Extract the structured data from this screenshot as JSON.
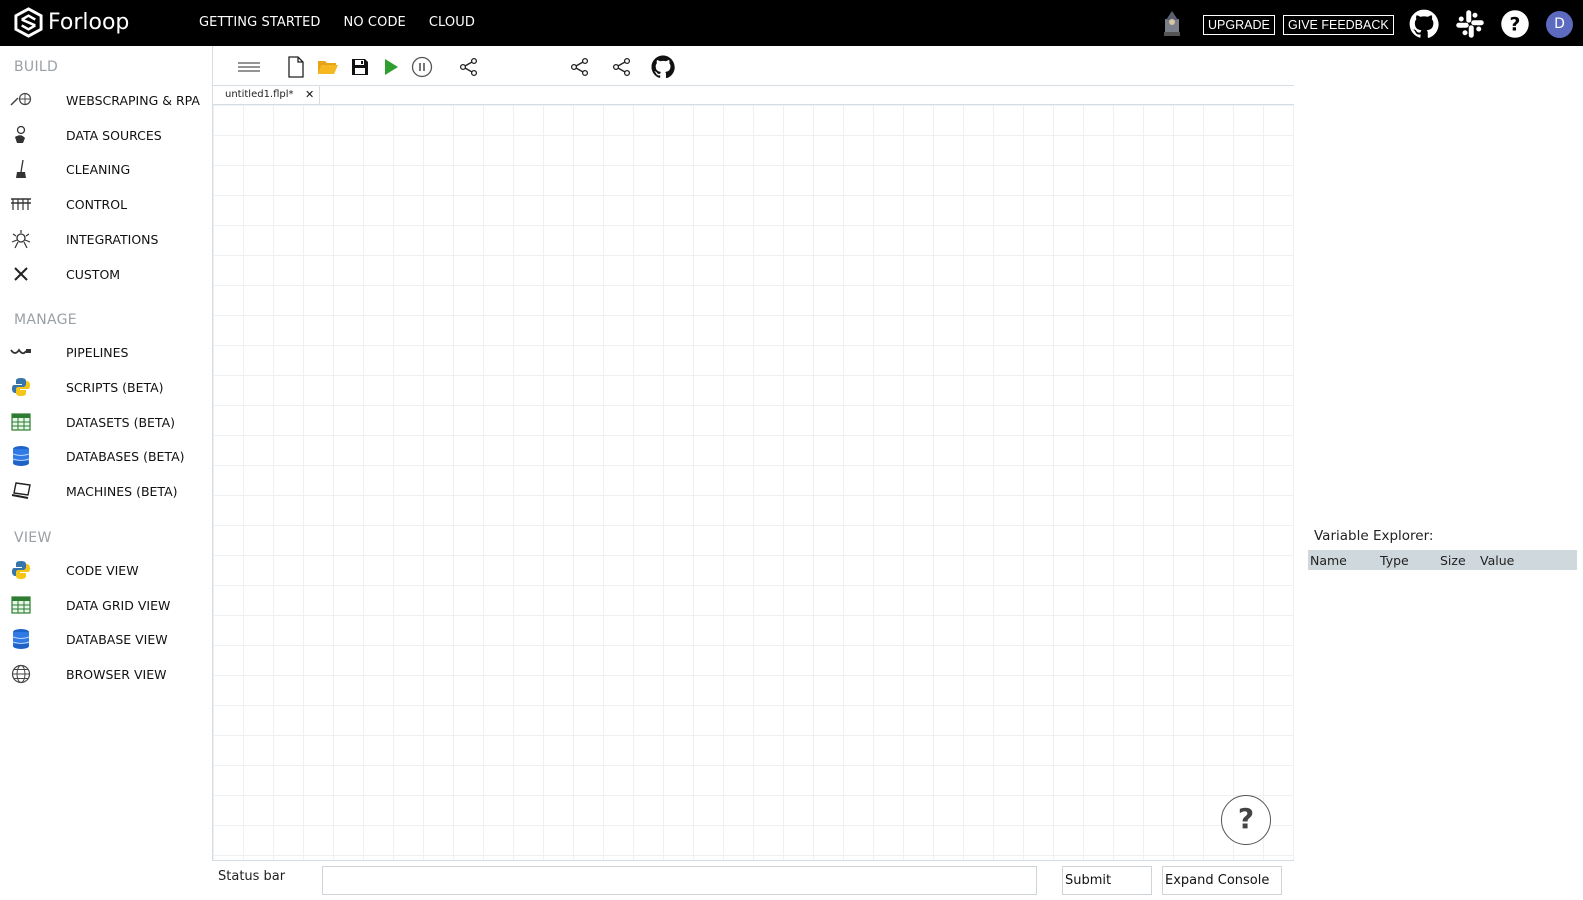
{
  "brand": {
    "name": "Forloop"
  },
  "topnav": {
    "getting_started": "GETTING STARTED",
    "no_code": "NO CODE",
    "cloud": "CLOUD"
  },
  "topright": {
    "upgrade": "UPGRADE",
    "feedback": "GIVE FEEDBACK",
    "user_initial": "D"
  },
  "sidebar": {
    "build_title": "BUILD",
    "build": [
      {
        "label": "WEBSCRAPING & RPA",
        "icon": "webscraping-icon"
      },
      {
        "label": "DATA SOURCES",
        "icon": "data-sources-icon"
      },
      {
        "label": "CLEANING",
        "icon": "broom-icon"
      },
      {
        "label": "CONTROL",
        "icon": "control-icon"
      },
      {
        "label": "INTEGRATIONS",
        "icon": "integrations-icon"
      },
      {
        "label": "CUSTOM",
        "icon": "tools-icon"
      }
    ],
    "manage_title": "MANAGE",
    "manage": [
      {
        "label": "PIPELINES",
        "icon": "pipelines-icon"
      },
      {
        "label": "SCRIPTS (BETA)",
        "icon": "python-icon"
      },
      {
        "label": "DATASETS (BETA)",
        "icon": "table-icon"
      },
      {
        "label": "DATABASES (BETA)",
        "icon": "database-icon"
      },
      {
        "label": "MACHINES (BETA)",
        "icon": "machine-icon"
      }
    ],
    "view_title": "VIEW",
    "view": [
      {
        "label": "CODE VIEW",
        "icon": "python-icon"
      },
      {
        "label": "DATA GRID VIEW",
        "icon": "table-icon"
      },
      {
        "label": "DATABASE VIEW",
        "icon": "database-icon"
      },
      {
        "label": "BROWSER VIEW",
        "icon": "globe-icon"
      }
    ]
  },
  "tabs": [
    {
      "label": "untitled1.flpl*"
    }
  ],
  "statusbar": {
    "label": "Status bar",
    "submit": "Submit",
    "expand": "Expand Console"
  },
  "variable_explorer": {
    "title": "Variable Explorer:",
    "columns": [
      "Name",
      "Type",
      "Size",
      "Value"
    ]
  },
  "help": {
    "label": "?"
  }
}
